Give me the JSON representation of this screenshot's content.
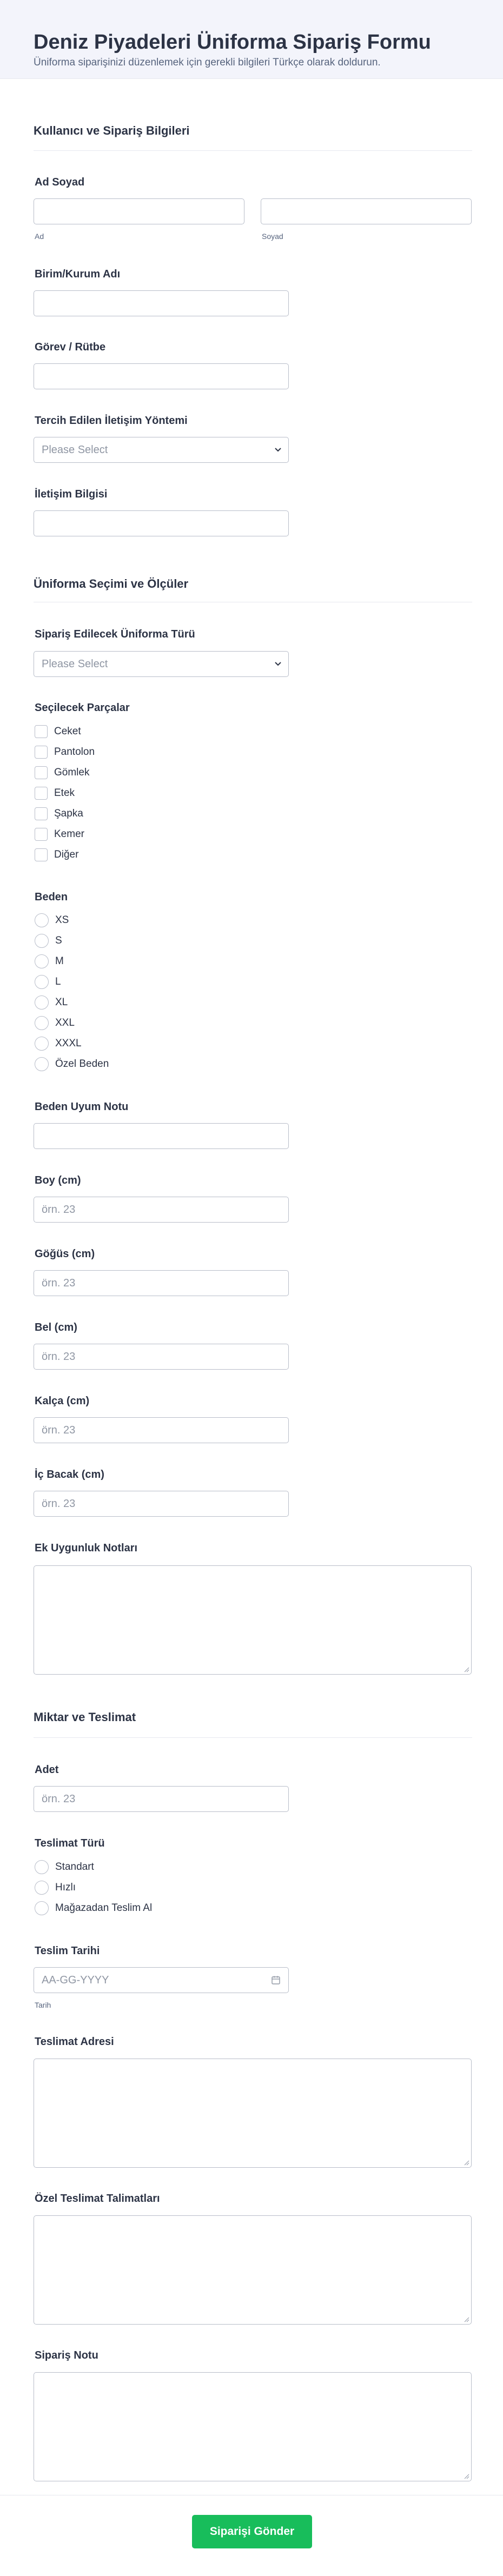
{
  "header": {
    "title": "Deniz Piyadeleri Üniforma Sipariş Formu",
    "subtitle": "Üniforma siparişinizi düzenlemek için gerekli bilgileri Türkçe olarak doldurun."
  },
  "sections": {
    "user_info": "Kullanıcı ve Sipariş Bilgileri",
    "uniform": "Üniforma Seçimi ve Ölçüler",
    "delivery": "Miktar ve Teslimat"
  },
  "fields": {
    "name": {
      "label": "Ad Soyad",
      "first_sub": "Ad",
      "last_sub": "Soyad"
    },
    "unit": {
      "label": "Birim/Kurum Adı"
    },
    "rank": {
      "label": "Görev / Rütbe"
    },
    "contact_method": {
      "label": "Tercih Edilen İletişim Yöntemi",
      "placeholder": "Please Select"
    },
    "contact_info": {
      "label": "İletişim Bilgisi"
    },
    "uniform_type": {
      "label": "Sipariş Edilecek Üniforma Türü",
      "placeholder": "Please Select"
    },
    "pieces": {
      "label": "Seçilecek Parçalar",
      "options": [
        "Ceket",
        "Pantolon",
        "Gömlek",
        "Etek",
        "Şapka",
        "Kemer",
        "Diğer"
      ]
    },
    "size": {
      "label": "Beden",
      "options": [
        "XS",
        "S",
        "M",
        "L",
        "XL",
        "XXL",
        "XXXL",
        "Özel Beden"
      ]
    },
    "fit_note": {
      "label": "Beden Uyum Notu"
    },
    "height": {
      "label": "Boy (cm)",
      "placeholder": "örn. 23"
    },
    "chest": {
      "label": "Göğüs (cm)",
      "placeholder": "örn. 23"
    },
    "waist": {
      "label": "Bel (cm)",
      "placeholder": "örn. 23"
    },
    "hip": {
      "label": "Kalça (cm)",
      "placeholder": "örn. 23"
    },
    "inseam": {
      "label": "İç Bacak (cm)",
      "placeholder": "örn. 23"
    },
    "fit_notes": {
      "label": "Ek Uygunluk Notları"
    },
    "quantity": {
      "label": "Adet",
      "placeholder": "örn. 23"
    },
    "delivery_type": {
      "label": "Teslimat Türü",
      "options": [
        "Standart",
        "Hızlı",
        "Mağazadan Teslim Al"
      ]
    },
    "delivery_date": {
      "label": "Teslim Tarihi",
      "placeholder": "AA-GG-YYYY",
      "sub": "Tarih"
    },
    "delivery_address": {
      "label": "Teslimat Adresi"
    },
    "special_instructions": {
      "label": "Özel Teslimat Talimatları"
    },
    "order_note": {
      "label": "Sipariş Notu"
    }
  },
  "footer": {
    "submit_label": "Siparişi Gönder"
  },
  "colors": {
    "accent": "#18bd5b",
    "border": "#b8bdc9",
    "text": "#2c3345"
  }
}
